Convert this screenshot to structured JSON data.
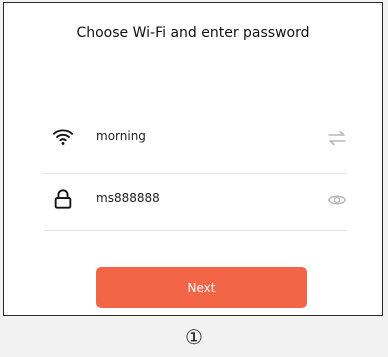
{
  "screen": {
    "title": "Choose Wi-Fi and enter password",
    "wifi": {
      "network_name": "morning",
      "icon": "wifi-icon",
      "switch_icon": "switch-arrows-icon"
    },
    "password": {
      "value": "ms888888",
      "icon": "lock-icon",
      "visibility_icon": "eye-icon"
    },
    "next_label": "Next",
    "accent_color": "#f26547"
  },
  "step_marker": "①"
}
